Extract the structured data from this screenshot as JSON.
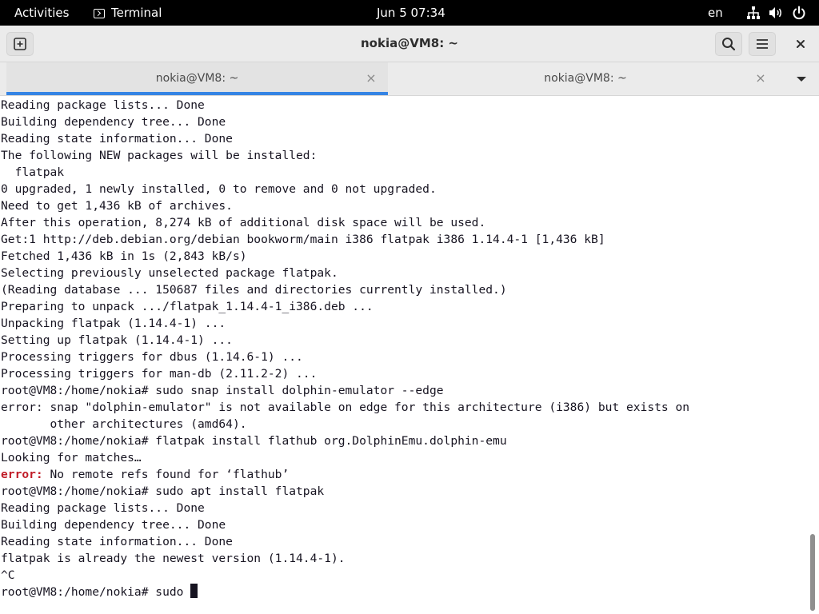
{
  "topbar": {
    "activities": "Activities",
    "app_name": "Terminal",
    "clock": "Jun 5  07:34",
    "language": "en",
    "network_icon": "network-icon",
    "volume_icon": "volume-icon",
    "power_icon": "power-icon"
  },
  "window": {
    "title": "nokia@VM8: ~",
    "buttons": [
      "new-tab-icon",
      "search-icon",
      "hamburger-menu-icon",
      "close-icon"
    ]
  },
  "tabs": [
    {
      "label": "nokia@VM8: ~",
      "active": true,
      "close": "×"
    },
    {
      "label": "nokia@VM8: ~",
      "active": false,
      "close": "×"
    }
  ],
  "colors": {
    "accent": "#3584e4",
    "error": "#c01c28",
    "text": "#171421"
  },
  "terminal": {
    "lines": [
      "Reading package lists... Done",
      "Building dependency tree... Done",
      "Reading state information... Done",
      "The following NEW packages will be installed:",
      "  flatpak",
      "0 upgraded, 1 newly installed, 0 to remove and 0 not upgraded.",
      "Need to get 1,436 kB of archives.",
      "After this operation, 8,274 kB of additional disk space will be used.",
      "Get:1 http://deb.debian.org/debian bookworm/main i386 flatpak i386 1.14.4-1 [1,436 kB]",
      "Fetched 1,436 kB in 1s (2,843 kB/s)",
      "Selecting previously unselected package flatpak.",
      "(Reading database ... 150687 files and directories currently installed.)",
      "Preparing to unpack .../flatpak_1.14.4-1_i386.deb ...",
      "Unpacking flatpak (1.14.4-1) ...",
      "Setting up flatpak (1.14.4-1) ...",
      "Processing triggers for dbus (1.14.6-1) ...",
      "Processing triggers for man-db (2.11.2-2) ...",
      "root@VM8:/home/nokia# sudo snap install dolphin-emulator --edge",
      "error: snap \"dolphin-emulator\" is not available on edge for this architecture (i386) but exists on",
      "       other architectures (amd64).",
      "root@VM8:/home/nokia# flatpak install flathub org.DolphinEmu.dolphin-emu",
      "Looking for matches…"
    ],
    "error_line": {
      "label": "error:",
      "message": " No remote refs found for ‘flathub’"
    },
    "lines_after": [
      "root@VM8:/home/nokia# sudo apt install flatpak",
      "Reading package lists... Done",
      "Building dependency tree... Done",
      "Reading state information... Done",
      "flatpak is already the newest version (1.14.4-1).",
      "^C"
    ],
    "prompt_line": "root@VM8:/home/nokia# sudo "
  }
}
